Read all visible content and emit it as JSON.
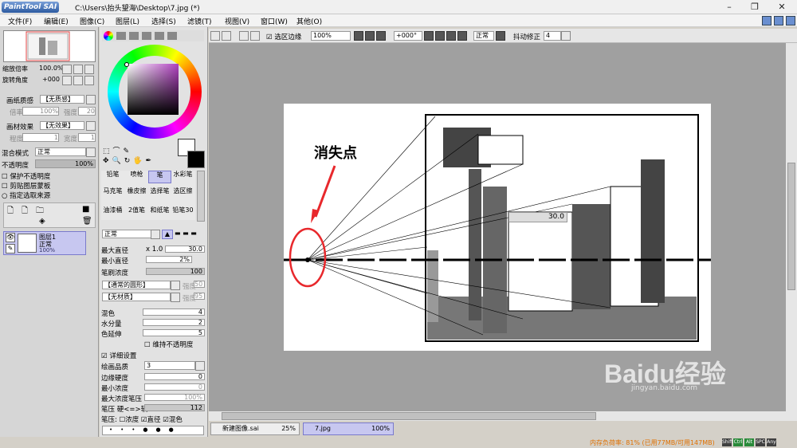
{
  "window": {
    "app_logo": "PaintTool SAI",
    "title": "C:\\Users\\抬头望海\\Desktop\\7.jpg (*)"
  },
  "menu": [
    "文件(F)",
    "编辑(E)",
    "图像(C)",
    "图层(L)",
    "选择(S)",
    "滤镜(T)",
    "视图(V)",
    "窗口(W)",
    "其他(O)"
  ],
  "navigator": {
    "zoom_label": "缩放倍率",
    "zoom_value": "100.0%",
    "rotate_label": "旋转角度",
    "rotate_value": "+000"
  },
  "paper": {
    "texture_label": "画纸质感",
    "texture_value": "【无质感】",
    "texture_scale_label": "倍率",
    "texture_scale_value": "100%",
    "texture_strength_label": "强度",
    "texture_strength_value": "20",
    "effect_label": "画材效果",
    "effect_value": "【无效果】",
    "effect_degree_label": "程度",
    "effect_degree_value": "1",
    "effect_width_label": "宽度",
    "effect_width_value": "1"
  },
  "layer_props": {
    "blend_label": "混合模式",
    "blend_value": "正常",
    "opacity_label": "不透明度",
    "opacity_value": "100%",
    "opacity": 1.0,
    "protect_opacity": "保护不透明度",
    "clip_group": "剪贴图层蒙板",
    "selection_source": "指定选取来源"
  },
  "layers": [
    {
      "name": "图层1",
      "mode": "正常",
      "opacity": "100%"
    }
  ],
  "tools": {
    "rows": [
      [
        "铅笔",
        "喷枪",
        "笔",
        "水彩笔"
      ],
      [
        "马克笔",
        "橡皮擦",
        "选择笔",
        "选区擦"
      ],
      [
        "油漆桶",
        "2值笔",
        "和纸笔",
        "铅笔30"
      ]
    ],
    "selected": "笔"
  },
  "brush": {
    "mode": "正常",
    "max_diameter_label": "最大直径",
    "max_diameter_mult": "x 1.0",
    "max_diameter_value": "30.0",
    "min_diameter_label": "最小直径",
    "min_diameter_value": "2%",
    "density_label": "笔刷浓度",
    "density_value": "100",
    "shape": "【通常的圆形】",
    "shape_strength_label": "强度",
    "shape_strength_value": "50",
    "texture": "【无材质】",
    "texture_strength_label": "强度",
    "texture_strength_value": "95",
    "blend_label": "混色",
    "blend_value": "4",
    "water_label": "水分量",
    "water_value": "2",
    "extend_label": "色延伸",
    "extend_value": "5",
    "keep_opacity": "维持不透明度",
    "detail": "详细设置",
    "quality_label": "绘画品质",
    "quality_value": "3",
    "edge_label": "边缘硬度",
    "edge_value": "0",
    "min_density_label": "最小浓度",
    "min_density_value": "0",
    "max_density_pressure_label": "最大浓度笔压",
    "max_density_pressure_value": "100%",
    "pressure_label": "笔压 硬<=>软",
    "pressure_value": "112",
    "pressure_opts_label": "笔压:",
    "pressure_density": "浓度",
    "pressure_diameter": "直径",
    "pressure_blend": "混色"
  },
  "canvas_toolbar": {
    "selection_edge": "选区边缘",
    "zoom": "100%",
    "rotate": "+000°",
    "mode": "正常",
    "stabilizer_label": "抖动修正",
    "stabilizer_value": "4"
  },
  "canvas": {
    "annotation": "消失点",
    "size_popup": "30.0"
  },
  "tabs": [
    {
      "name": "新建图像.sai",
      "zoom": "25%"
    },
    {
      "name": "7.jpg",
      "zoom": "100%"
    }
  ],
  "status": {
    "memory": "内存负荷率: 81% (已用77MB/可用147MB)",
    "keys": [
      "Shift",
      "Ctrl",
      "Alt",
      "SPC",
      "Any"
    ]
  },
  "watermark": {
    "logo": "Baidu经验",
    "url": "jingyan.baidu.com"
  },
  "colors": {
    "selection": "#c7c7f0",
    "annotation": "#e8282c",
    "accent": "#7a7acc"
  }
}
